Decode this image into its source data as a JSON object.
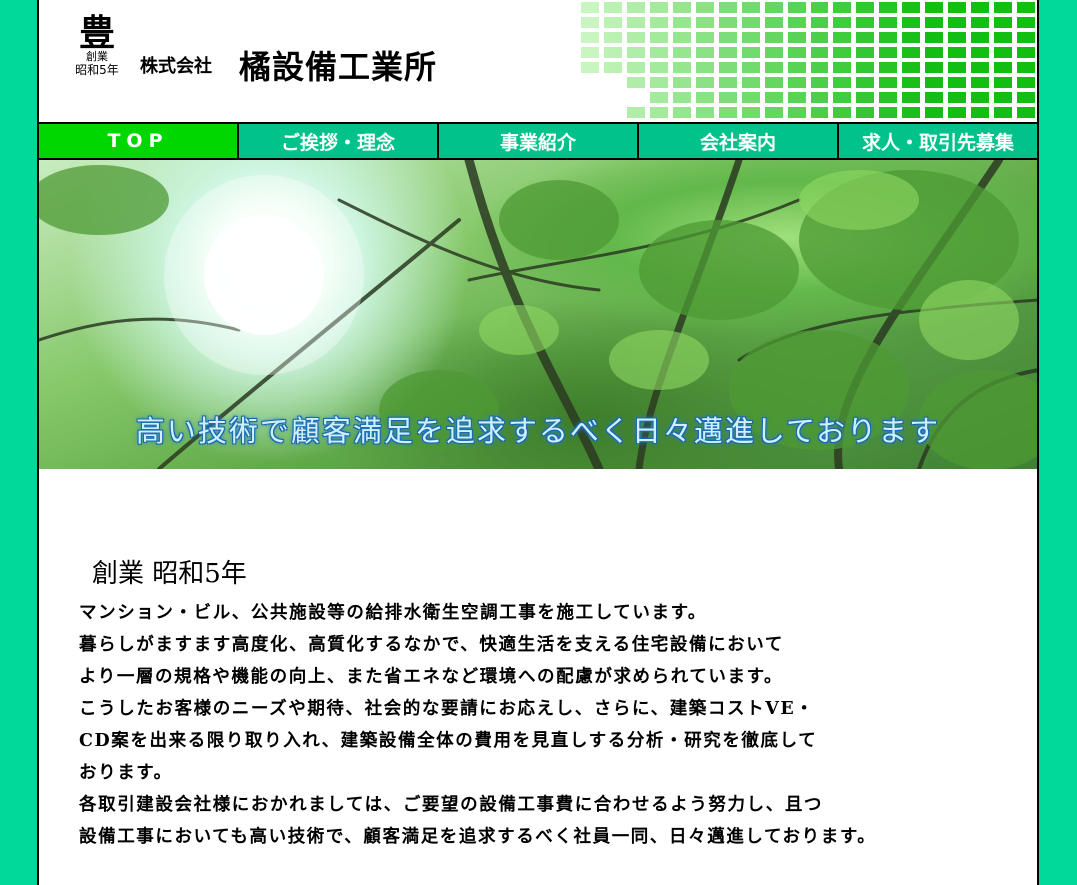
{
  "header": {
    "crest_glyph": "豊",
    "founded_label": "創業",
    "founded_year": "昭和5年",
    "company_prefix": "株式会社",
    "company_name": "橘設備工業所"
  },
  "nav": {
    "items": [
      {
        "label": "TOP",
        "active": true
      },
      {
        "label": "ご挨拶・理念",
        "active": false
      },
      {
        "label": "事業紹介",
        "active": false
      },
      {
        "label": "会社案内",
        "active": false
      },
      {
        "label": "求人・取引先募集",
        "active": false
      }
    ]
  },
  "hero": {
    "caption": "高い技術で顧客満足を追求するべく日々邁進しております"
  },
  "content": {
    "heading": "創業 昭和5年",
    "lines": [
      "マンション・ビル、公共施設等の給排水衛生空調工事を施工しています。",
      "暮らしがますます高度化、高質化するなかで、快適生活を支える住宅設備において",
      "より一層の規格や機能の向上、また省エネなど環境への配慮が求められています。",
      "こうしたお客様のニーズや期待、社会的な要請にお応えし、さらに、建築コストVE・",
      "CD案を出来る限り取り入れ、建築設備全体の費用を見直しする分析・研究を徹底して",
      "おります。",
      "各取引建設会社様におかれましては、ご要望の設備工事費に合わせるよう努力し、且つ",
      "設備工事においても高い技術で、顧客満足を追求するべく社員一同、日々邁進しております。"
    ]
  },
  "colors": {
    "page_background": "#00d99a",
    "nav_background": "#00c28a",
    "nav_active": "#00d600",
    "tile_light": "#c8f5c0",
    "tile_dark": "#1fc61f"
  }
}
